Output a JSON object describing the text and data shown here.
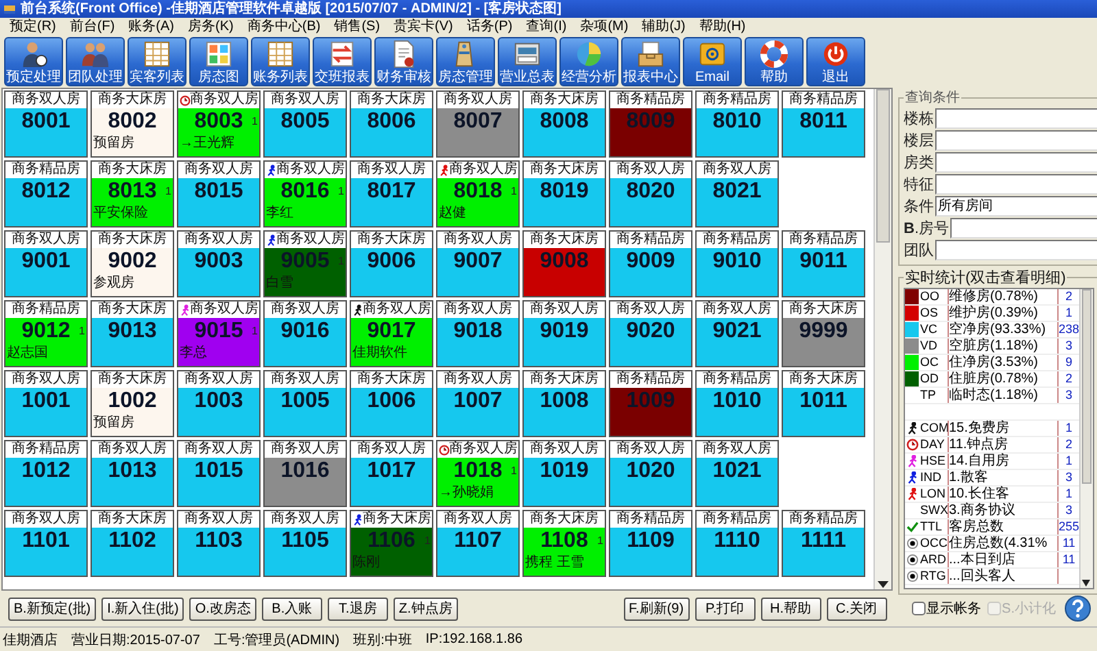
{
  "window": {
    "title": "前台系统(Front Office) -佳期酒店管理软件卓越版 [2015/07/07 - ADMIN/2] - [客房状态图]"
  },
  "menu": [
    "预定(R)",
    "前台(F)",
    "账务(A)",
    "房务(K)",
    "商务中心(B)",
    "销售(S)",
    "贵宾卡(V)",
    "话务(P)",
    "查询(I)",
    "杂项(M)",
    "辅助(J)",
    "帮助(H)"
  ],
  "toolbar": [
    "预定处理",
    "团队处理",
    "宾客列表",
    "房态图",
    "账务列表",
    "交班报表",
    "财务审核",
    "房态管理",
    "营业总表",
    "经营分析",
    "报表中心",
    "Email",
    "帮助",
    "退出"
  ],
  "room_rows": [
    {
      "rooms": [
        {
          "type": "商务双人房",
          "number": "8001",
          "color": "#16c8ee"
        },
        {
          "type": "商务大床房",
          "number": "8002",
          "color": "#fdf6ee",
          "guest": "预留房"
        },
        {
          "type": "商务双人房",
          "number": "8003",
          "color": "#00f000",
          "kind": "day",
          "guest": "→王光辉",
          "count": "1"
        },
        {
          "type": "商务双人房",
          "number": "8005",
          "color": "#16c8ee"
        },
        {
          "type": "商务大床房",
          "number": "8006",
          "color": "#16c8ee"
        },
        {
          "type": "商务双人房",
          "number": "8007",
          "color": "#8c8c8c"
        },
        {
          "type": "商务大床房",
          "number": "8008",
          "color": "#16c8ee"
        },
        {
          "type": "商务精品房",
          "number": "8009",
          "color": "#7a0000"
        },
        {
          "type": "商务精品房",
          "number": "8010",
          "color": "#16c8ee"
        },
        {
          "type": "商务精品房",
          "number": "8011",
          "color": "#16c8ee"
        }
      ]
    },
    {
      "rooms": [
        {
          "type": "商务精品房",
          "number": "8012",
          "color": "#16c8ee"
        },
        {
          "type": "商务大床房",
          "number": "8013",
          "color": "#00f000",
          "guest": "平安保险",
          "count": "1"
        },
        {
          "type": "商务双人房",
          "number": "8015",
          "color": "#16c8ee"
        },
        {
          "type": "商务双人房",
          "number": "8016",
          "color": "#00f000",
          "kind": "walk-blue",
          "guest": "李红",
          "count": "1"
        },
        {
          "type": "商务双人房",
          "number": "8017",
          "color": "#16c8ee"
        },
        {
          "type": "商务双人房",
          "number": "8018",
          "color": "#00f000",
          "kind": "walk-red",
          "guest": "赵健",
          "count": "1"
        },
        {
          "type": "商务大床房",
          "number": "8019",
          "color": "#16c8ee"
        },
        {
          "type": "商务双人房",
          "number": "8020",
          "color": "#16c8ee"
        },
        {
          "type": "商务双人房",
          "number": "8021",
          "color": "#16c8ee"
        }
      ]
    },
    {
      "rooms": [
        {
          "type": "商务双人房",
          "number": "9001",
          "color": "#16c8ee"
        },
        {
          "type": "商务大床房",
          "number": "9002",
          "color": "#fdf6ee",
          "guest": "参观房"
        },
        {
          "type": "商务双人房",
          "number": "9003",
          "color": "#16c8ee"
        },
        {
          "type": "商务双人房",
          "number": "9005",
          "color": "#006000",
          "kind": "walk-blue",
          "guest": "白雪",
          "count": "1"
        },
        {
          "type": "商务大床房",
          "number": "9006",
          "color": "#16c8ee"
        },
        {
          "type": "商务双人房",
          "number": "9007",
          "color": "#16c8ee"
        },
        {
          "type": "商务大床房",
          "number": "9008",
          "color": "#c80000"
        },
        {
          "type": "商务精品房",
          "number": "9009",
          "color": "#16c8ee"
        },
        {
          "type": "商务精品房",
          "number": "9010",
          "color": "#16c8ee"
        },
        {
          "type": "商务精品房",
          "number": "9011",
          "color": "#16c8ee"
        }
      ]
    },
    {
      "rooms": [
        {
          "type": "商务精品房",
          "number": "9012",
          "color": "#00f000",
          "guest": "赵志国",
          "count": "1"
        },
        {
          "type": "商务大床房",
          "number": "9013",
          "color": "#16c8ee"
        },
        {
          "type": "商务双人房",
          "number": "9015",
          "color": "#a000f0",
          "kind": "walk-pink",
          "guest": "李总",
          "count": "1"
        },
        {
          "type": "商务双人房",
          "number": "9016",
          "color": "#16c8ee"
        },
        {
          "type": "商务双人房",
          "number": "9017",
          "color": "#00f000",
          "kind": "walk-black",
          "guest": "佳期软件"
        },
        {
          "type": "商务双人房",
          "number": "9018",
          "color": "#16c8ee"
        },
        {
          "type": "商务双人房",
          "number": "9019",
          "color": "#16c8ee"
        },
        {
          "type": "商务双人房",
          "number": "9020",
          "color": "#16c8ee"
        },
        {
          "type": "商务双人房",
          "number": "9021",
          "color": "#16c8ee"
        },
        {
          "type": "商务大床房",
          "number": "9999",
          "color": "#8c8c8c"
        }
      ]
    },
    {
      "rooms": [
        {
          "type": "商务双人房",
          "number": "1001",
          "color": "#16c8ee"
        },
        {
          "type": "商务大床房",
          "number": "1002",
          "color": "#fdf6ee",
          "guest": "预留房"
        },
        {
          "type": "商务双人房",
          "number": "1003",
          "color": "#16c8ee"
        },
        {
          "type": "商务双人房",
          "number": "1005",
          "color": "#16c8ee"
        },
        {
          "type": "商务大床房",
          "number": "1006",
          "color": "#16c8ee"
        },
        {
          "type": "商务双人房",
          "number": "1007",
          "color": "#16c8ee"
        },
        {
          "type": "商务大床房",
          "number": "1008",
          "color": "#16c8ee"
        },
        {
          "type": "商务精品房",
          "number": "1009",
          "color": "#7a0000"
        },
        {
          "type": "商务精品房",
          "number": "1010",
          "color": "#16c8ee"
        },
        {
          "type": "商务大床房",
          "number": "1011",
          "color": "#16c8ee"
        }
      ]
    },
    {
      "rooms": [
        {
          "type": "商务精品房",
          "number": "1012",
          "color": "#16c8ee"
        },
        {
          "type": "商务双人房",
          "number": "1013",
          "color": "#16c8ee"
        },
        {
          "type": "商务双人房",
          "number": "1015",
          "color": "#16c8ee"
        },
        {
          "type": "商务双人房",
          "number": "1016",
          "color": "#8c8c8c"
        },
        {
          "type": "商务双人房",
          "number": "1017",
          "color": "#16c8ee"
        },
        {
          "type": "商务双人房",
          "number": "1018",
          "color": "#00f000",
          "kind": "day",
          "guest": "→孙晓娟",
          "count": "1"
        },
        {
          "type": "商务双人房",
          "number": "1019",
          "color": "#16c8ee"
        },
        {
          "type": "商务双人房",
          "number": "1020",
          "color": "#16c8ee"
        },
        {
          "type": "商务双人房",
          "number": "1021",
          "color": "#16c8ee"
        }
      ]
    },
    {
      "rooms": [
        {
          "type": "商务双人房",
          "number": "1101",
          "color": "#16c8ee"
        },
        {
          "type": "商务大床房",
          "number": "1102",
          "color": "#16c8ee"
        },
        {
          "type": "商务双人房",
          "number": "1103",
          "color": "#16c8ee"
        },
        {
          "type": "商务双人房",
          "number": "1105",
          "color": "#16c8ee"
        },
        {
          "type": "商务大床房",
          "number": "1106",
          "color": "#006000",
          "kind": "walk-blue",
          "guest": "陈刚",
          "count": "1"
        },
        {
          "type": "商务双人房",
          "number": "1107",
          "color": "#16c8ee"
        },
        {
          "type": "商务大床房",
          "number": "1108",
          "color": "#00f000",
          "guest": "携程 王雪",
          "count": "1"
        },
        {
          "type": "商务精品房",
          "number": "1109",
          "color": "#16c8ee"
        },
        {
          "type": "商务精品房",
          "number": "1110",
          "color": "#16c8ee"
        },
        {
          "type": "商务精品房",
          "number": "1111",
          "color": "#16c8ee"
        }
      ]
    }
  ],
  "query": {
    "legend": "查询条件",
    "fields": [
      {
        "label": "楼栋"
      },
      {
        "label": "楼层"
      },
      {
        "label": "房类"
      },
      {
        "label": "特征"
      },
      {
        "label": "条件",
        "value": "所有房间"
      },
      {
        "label": "**B**.房号"
      },
      {
        "label": "团队"
      }
    ]
  },
  "stats": {
    "legend": "实时统计(双击查看明细)",
    "rows": [
      {
        "kind": "swatch",
        "color": "#800000",
        "code": "OO",
        "label": "维修房(0.78%)",
        "count": "2"
      },
      {
        "kind": "swatch",
        "color": "#d40000",
        "code": "OS",
        "label": "维护房(0.39%)",
        "count": "1"
      },
      {
        "kind": "swatch",
        "color": "#16c8ee",
        "code": "VC",
        "label": "空净房(93.33%)",
        "count": "238"
      },
      {
        "kind": "swatch",
        "color": "#8c8c8c",
        "code": "VD",
        "label": "空脏房(1.18%)",
        "count": "3"
      },
      {
        "kind": "swatch",
        "color": "#00f000",
        "code": "OC",
        "label": "住净房(3.53%)",
        "count": "9"
      },
      {
        "kind": "swatch",
        "color": "#006000",
        "code": "OD",
        "label": "住脏房(0.78%)",
        "count": "2"
      },
      {
        "kind": "plain",
        "code": "TP",
        "label": "临时态(1.18%)",
        "count": "3"
      },
      {
        "kind": "blank"
      },
      {
        "kind": "walk-black",
        "code": "COM",
        "label": "15.免费房",
        "count": "1"
      },
      {
        "kind": "day",
        "code": "DAY",
        "label": "11.钟点房",
        "count": "2"
      },
      {
        "kind": "walk-pink",
        "code": "HSE",
        "label": "14.自用房",
        "count": "1"
      },
      {
        "kind": "walk-blue",
        "code": "IND",
        "label": "1.散客",
        "count": "3"
      },
      {
        "kind": "walk-red",
        "code": "LON",
        "label": "10.长住客",
        "count": "1"
      },
      {
        "kind": "plain",
        "code": "SWX",
        "label": "3.商务协议",
        "count": "3"
      },
      {
        "kind": "check",
        "code": "TTL",
        "label": "客房总数",
        "count": "255"
      },
      {
        "kind": "radio",
        "code": "OCC",
        "label": "住房总数(4.31%",
        "count": "11"
      },
      {
        "kind": "radio",
        "code": "ARD",
        "label": "...本日到店",
        "count": "11"
      },
      {
        "kind": "radio",
        "code": "RTG",
        "label": "...回头客人"
      }
    ]
  },
  "actions_left": [
    "B.新预定(批)",
    "I.新入住(批)",
    "O.改房态",
    "B.入账",
    "T.退房",
    "Z.钟点房"
  ],
  "actions_right": [
    "F.刷新(9)",
    "P.打印",
    "H.帮助",
    "C.关闭"
  ],
  "options": [
    {
      "label": "显示帐务",
      "checked": false,
      "disabled": false
    },
    {
      "label": "S.小计化",
      "checked": false,
      "disabled": true
    }
  ],
  "status_bar": [
    "佳期酒店",
    "营业日期:2015-07-07",
    "工号:管理员(ADMIN)",
    "班别:中班",
    "IP:192.168.1.86"
  ]
}
